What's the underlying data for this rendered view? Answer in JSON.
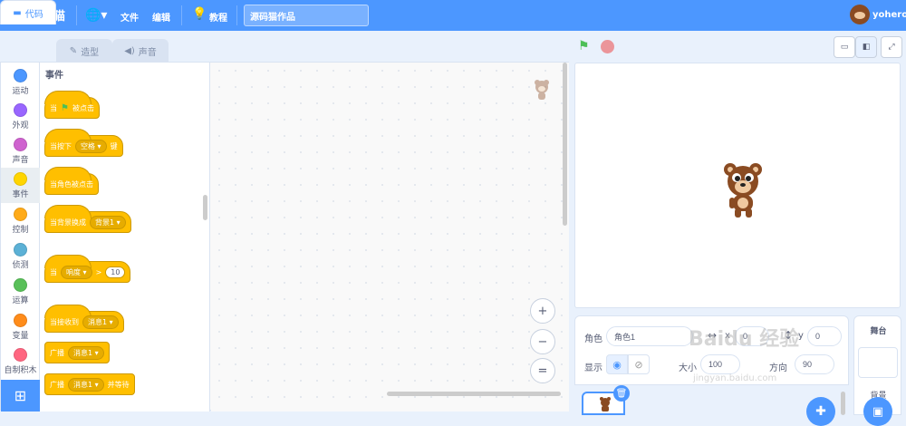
{
  "topbar": {
    "logo_text": "编码猫",
    "file_menu": "文件",
    "edit_menu": "编辑",
    "tutorial_menu": "教程",
    "project_title": "源码猫作品",
    "username": "yohero"
  },
  "tabs": {
    "code": "代码",
    "costumes": "造型",
    "sounds": "声音"
  },
  "categories": [
    {
      "label": "运动",
      "color": "#4c97ff"
    },
    {
      "label": "外观",
      "color": "#9966ff"
    },
    {
      "label": "声音",
      "color": "#cf63cf"
    },
    {
      "label": "事件",
      "color": "#ffd500"
    },
    {
      "label": "控制",
      "color": "#ffab19"
    },
    {
      "label": "侦测",
      "color": "#5cb1d6"
    },
    {
      "label": "运算",
      "color": "#59c059"
    },
    {
      "label": "变量",
      "color": "#ff8c1a"
    },
    {
      "label": "自制积木",
      "color": "#ff6680"
    }
  ],
  "palette": {
    "title": "事件",
    "blocks": {
      "flag_clicked_pre": "当",
      "flag_clicked_post": "被点击",
      "key_pressed_pre": "当按下",
      "key_pressed_key": "空格",
      "key_pressed_post": "键",
      "sprite_clicked": "当角色被点击",
      "backdrop_switch_pre": "当背景换成",
      "backdrop_switch_value": "背景1",
      "loudness_pre": "当",
      "loudness_value": "响度",
      "loudness_op": ">",
      "loudness_num": "10",
      "receive_pre": "当接收到",
      "receive_value": "消息1",
      "broadcast_pre": "广播",
      "broadcast_value": "消息1",
      "broadcast_wait_pre": "广播",
      "broadcast_wait_value": "消息1",
      "broadcast_wait_post": "并等待"
    }
  },
  "zoom": {
    "in": "+",
    "out": "−",
    "reset": "="
  },
  "sprite_info": {
    "sprite_label": "角色",
    "sprite_name": "角色1",
    "x_label": "x",
    "x_value": "0",
    "y_label": "y",
    "y_value": "0",
    "show_label": "显示",
    "size_label": "大小",
    "size_value": "100",
    "direction_label": "方向",
    "direction_value": "90"
  },
  "stage_pane": {
    "title": "舞台",
    "backdrop_label": "背景"
  },
  "watermark": {
    "text": "Baidu 经验",
    "url": "jingyan.baidu.com"
  }
}
